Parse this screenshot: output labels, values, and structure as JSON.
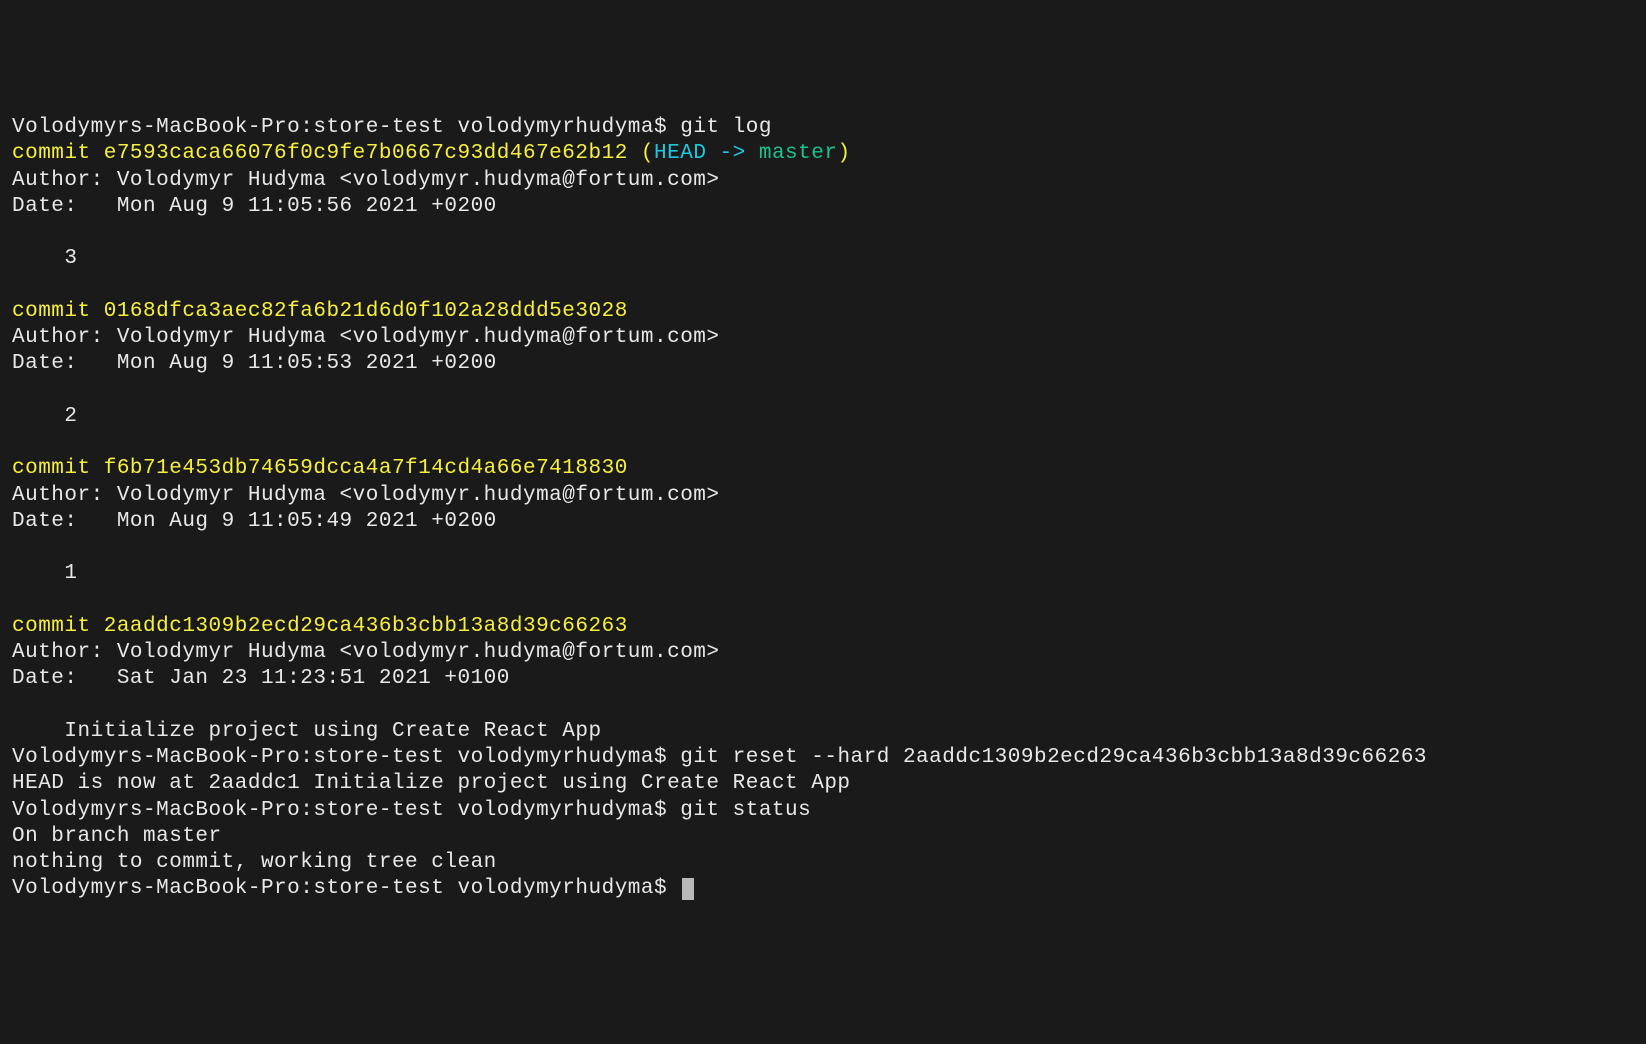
{
  "prompt": "Volodymyrs-MacBook-Pro:store-test volodymyrhudyma$ ",
  "commands": {
    "gitlog": "git log",
    "gitreset": "git reset --hard 2aaddc1309b2ecd29ca436b3cbb13a8d39c66263",
    "gitstatus": "git status"
  },
  "commits": [
    {
      "hash": "commit e7593caca66076f0c9fe7b0667c93dd467e62b12",
      "ref_open": " (",
      "ref_head": "HEAD -> ",
      "ref_branch": "master",
      "ref_close": ")",
      "author": "Author: Volodymyr Hudyma <volodymyr.hudyma@fortum.com>",
      "date": "Date:   Mon Aug 9 11:05:56 2021 +0200",
      "message": "    3"
    },
    {
      "hash": "commit 0168dfca3aec82fa6b21d6d0f102a28ddd5e3028",
      "author": "Author: Volodymyr Hudyma <volodymyr.hudyma@fortum.com>",
      "date": "Date:   Mon Aug 9 11:05:53 2021 +0200",
      "message": "    2"
    },
    {
      "hash": "commit f6b71e453db74659dcca4a7f14cd4a66e7418830",
      "author": "Author: Volodymyr Hudyma <volodymyr.hudyma@fortum.com>",
      "date": "Date:   Mon Aug 9 11:05:49 2021 +0200",
      "message": "    1"
    },
    {
      "hash": "commit 2aaddc1309b2ecd29ca436b3cbb13a8d39c66263",
      "author": "Author: Volodymyr Hudyma <volodymyr.hudyma@fortum.com>",
      "date": "Date:   Sat Jan 23 11:23:51 2021 +0100",
      "message": "    Initialize project using Create React App"
    }
  ],
  "reset_output": "HEAD is now at 2aaddc1 Initialize project using Create React App",
  "status_output": {
    "branch": "On branch master",
    "clean": "nothing to commit, working tree clean"
  }
}
